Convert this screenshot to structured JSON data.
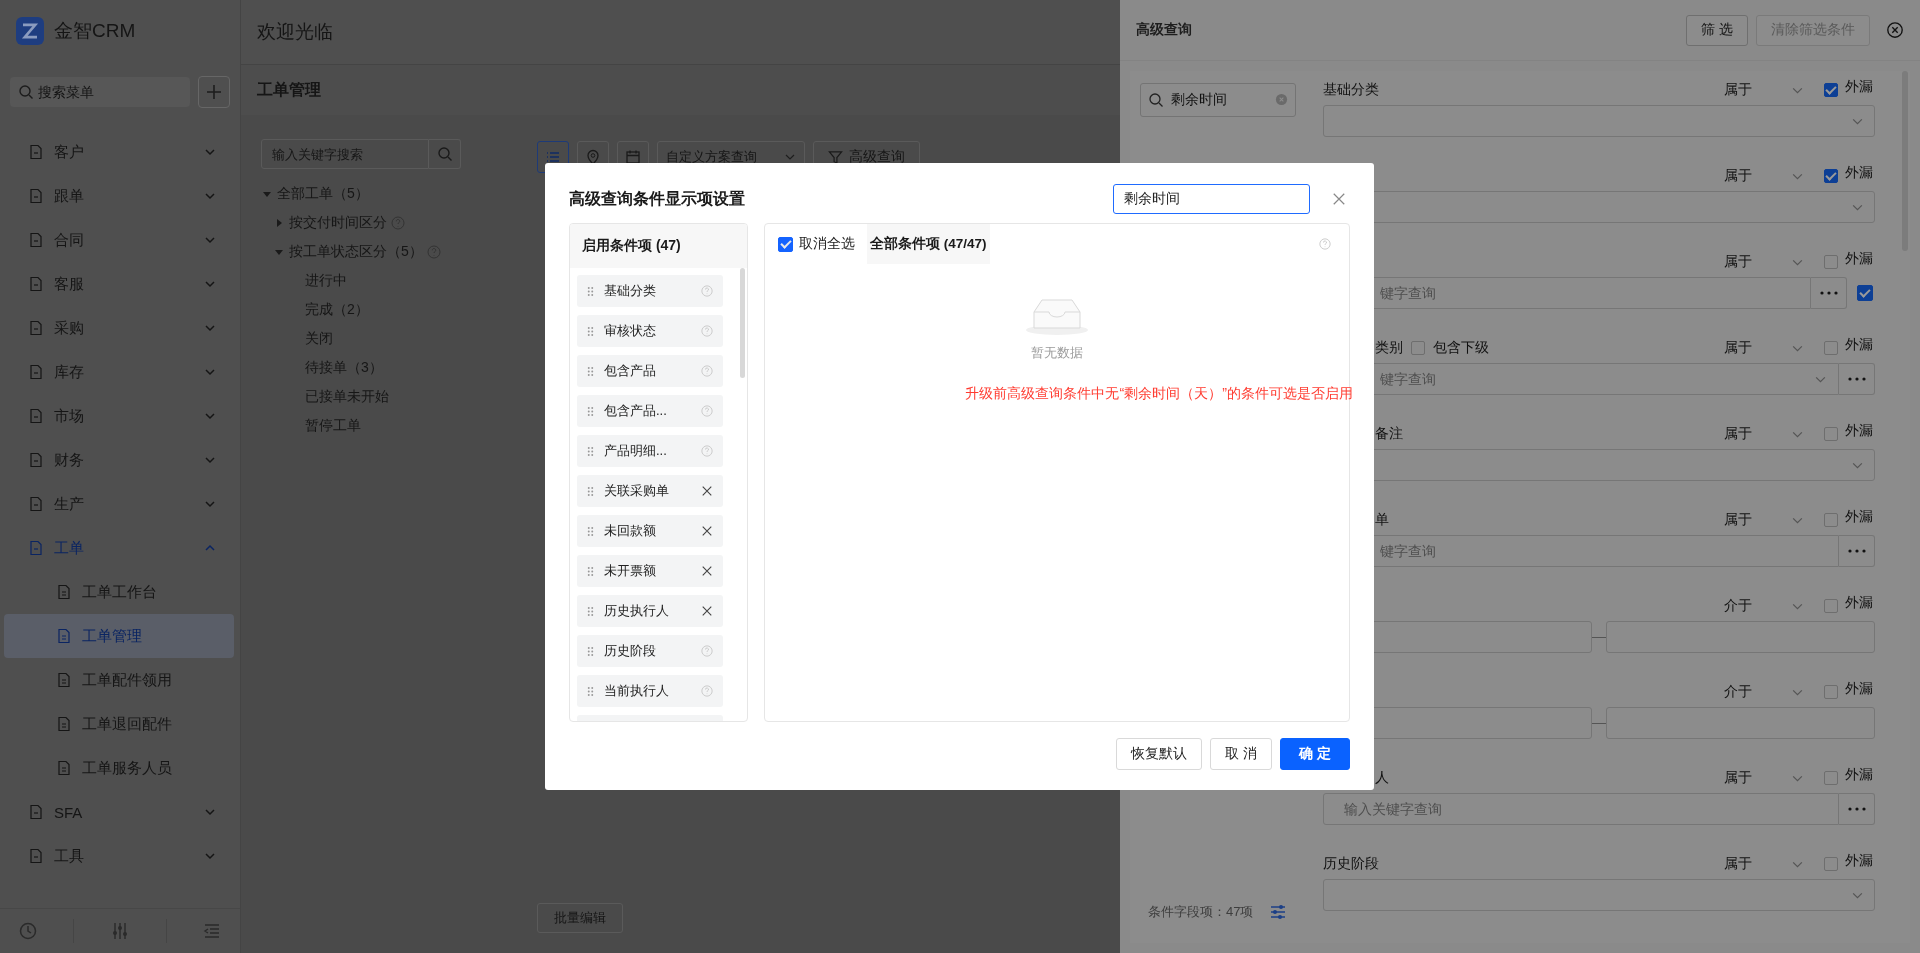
{
  "sidebar": {
    "app_name": "金智CRM",
    "search": {
      "placeholder": "搜索菜单"
    },
    "menu": [
      {
        "label": "客户",
        "expanded": false
      },
      {
        "label": "跟单",
        "expanded": false
      },
      {
        "label": "合同",
        "expanded": false
      },
      {
        "label": "客服",
        "expanded": false
      },
      {
        "label": "采购",
        "expanded": false
      },
      {
        "label": "库存",
        "expanded": false
      },
      {
        "label": "市场",
        "expanded": false
      },
      {
        "label": "财务",
        "expanded": false
      },
      {
        "label": "生产",
        "expanded": false
      },
      {
        "label": "工单",
        "expanded": true,
        "children": [
          {
            "label": "工单工作台",
            "selected": false
          },
          {
            "label": "工单管理",
            "selected": true
          },
          {
            "label": "工单配件领用",
            "selected": false
          },
          {
            "label": "工单退回配件",
            "selected": false
          },
          {
            "label": "工单服务人员",
            "selected": false
          }
        ]
      },
      {
        "label": "SFA",
        "expanded": false
      },
      {
        "label": "工具",
        "expanded": false
      }
    ]
  },
  "header": {
    "title": "欢迎光临"
  },
  "page": {
    "title": "工单管理",
    "tree_search": {
      "placeholder": "输入关键字搜索"
    },
    "tree": [
      {
        "label": "全部工单（5）",
        "expanded": true,
        "help": false,
        "children": [
          {
            "label": "按交付时间区分",
            "expanded": false,
            "help": true
          },
          {
            "label": "按工单状态区分（5）",
            "expanded": true,
            "help": true,
            "children": [
              {
                "label": "进行中",
                "help": false
              },
              {
                "label": "完成（2）",
                "help": false
              },
              {
                "label": "关闭",
                "help": false
              },
              {
                "label": "待接单（3）",
                "help": false
              },
              {
                "label": "已接单未开始",
                "help": false
              },
              {
                "label": "暂停工单",
                "help": false
              }
            ]
          }
        ]
      }
    ],
    "view_buttons": [
      {
        "kind": "list",
        "selected": true
      },
      {
        "kind": "map",
        "selected": false
      },
      {
        "kind": "calendar",
        "selected": false
      }
    ],
    "scheme_select": {
      "placeholder": "自定义方案查询"
    },
    "advanced_button": "高级查询",
    "batch_button": "批量编辑"
  },
  "drawer": {
    "title": "高级查询",
    "filter_button": "筛 选",
    "clear_button": {
      "label": "清除筛选条件",
      "disabled": true
    },
    "search": {
      "value": "剩余时间"
    },
    "field_count": "条件字段项：47项",
    "rows": [
      {
        "label": "基础分类",
        "label_cut": false,
        "operator": "属于",
        "leak_label": "外漏",
        "leaked": true,
        "kind": "select"
      },
      {
        "operator": "属于",
        "leak_label": "外漏",
        "leaked": true,
        "kind": "select"
      },
      {
        "operator": "属于",
        "leak_label": "外漏",
        "leaked": false,
        "kind": "lookup",
        "placeholder": "键字查询",
        "input_cut": true,
        "extra_check": {
          "checked": true
        }
      },
      {
        "label": "类别",
        "label_cut": true,
        "sub_option": {
          "label": "包含下级",
          "checked": false
        },
        "operator": "属于",
        "leak_label": "外漏",
        "leaked": false,
        "kind": "lookup_select",
        "placeholder": "键字查询",
        "input_cut": true
      },
      {
        "label": "备注",
        "label_cut": true,
        "operator": "属于",
        "leak_label": "外漏",
        "leaked": false,
        "kind": "select"
      },
      {
        "label": "单",
        "label_cut": true,
        "operator": "属于",
        "leak_label": "外漏",
        "leaked": false,
        "kind": "lookup",
        "placeholder": "键字查询",
        "input_cut": true
      },
      {
        "operator": "介于",
        "leak_label": "外漏",
        "leaked": false,
        "kind": "range"
      },
      {
        "operator": "介于",
        "leak_label": "外漏",
        "leaked": false,
        "kind": "range"
      },
      {
        "label": "人",
        "label_cut": true,
        "operator": "属于",
        "leak_label": "外漏",
        "leaked": false,
        "kind": "lookup",
        "placeholder": "输入关键字查询",
        "input_cut": false
      },
      {
        "label": "历史阶段",
        "label_cut": false,
        "operator": "属于",
        "leak_label": "外漏",
        "leaked": false,
        "kind": "select"
      }
    ]
  },
  "dialog": {
    "title": "高级查询条件显示项设置",
    "search": {
      "value": "剩余时间"
    },
    "enabled_title": "启用条件项 (47)",
    "enabled_items": [
      {
        "label": "基础分类",
        "kind": "help"
      },
      {
        "label": "审核状态",
        "kind": "help"
      },
      {
        "label": "包含产品",
        "kind": "help"
      },
      {
        "label": "包含产品...",
        "kind": "help"
      },
      {
        "label": "产品明细...",
        "kind": "help"
      },
      {
        "label": "关联采购单",
        "kind": "removable"
      },
      {
        "label": "未回款额",
        "kind": "removable"
      },
      {
        "label": "未开票额",
        "kind": "removable"
      },
      {
        "label": "历史执行人",
        "kind": "removable"
      },
      {
        "label": "历史阶段",
        "kind": "help"
      },
      {
        "label": "当前执行人",
        "kind": "help"
      }
    ],
    "select_all": {
      "label": "取消全选",
      "checked": true
    },
    "all_tab": "全部条件项 (47/47)",
    "empty_text": "暂无数据",
    "annotation": "升级前高级查询条件中无“剩余时间（天）”的条件可选是否启用",
    "buttons": [
      {
        "label": "恢复默认",
        "kind": "default"
      },
      {
        "label": "取 消",
        "kind": "default"
      },
      {
        "label": "确 定",
        "kind": "primary"
      }
    ]
  }
}
